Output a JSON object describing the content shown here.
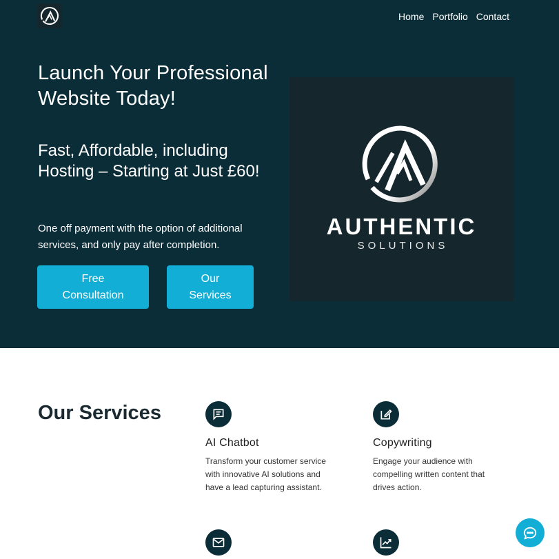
{
  "header": {
    "logo_icon": "authentic-solutions-logo-icon",
    "nav": [
      "Home",
      "Portfolio",
      "Contact"
    ]
  },
  "hero": {
    "title": "Launch Your Professional Website Today!",
    "subtitle": "Fast, Affordable, including Hosting – Starting at Just £60!",
    "description": "One off payment with the option of additional services, and only pay after completion.",
    "buttons": {
      "consultation": "Free Consultation",
      "services": "Our Services"
    },
    "brand": {
      "name": "AUTHENTIC",
      "tagline": "SOLUTIONS"
    }
  },
  "services": {
    "title": "Our Services",
    "items": [
      {
        "name": "AI Chatbot",
        "icon": "chat-icon",
        "description": "Transform your customer service with innovative AI solutions and have a lead capturing assistant."
      },
      {
        "name": "Copywriting",
        "icon": "edit-icon",
        "description": "Engage your audience with compelling written content that drives action."
      },
      {
        "name": "",
        "icon": "mail-icon",
        "description": ""
      },
      {
        "name": "",
        "icon": "chart-icon",
        "description": ""
      }
    ]
  },
  "chat_widget": {
    "icon": "chat-bubble-icon"
  },
  "colors": {
    "hero_bg": "#0b2d38",
    "accent": "#12aed6",
    "image_bg": "#16262d"
  }
}
